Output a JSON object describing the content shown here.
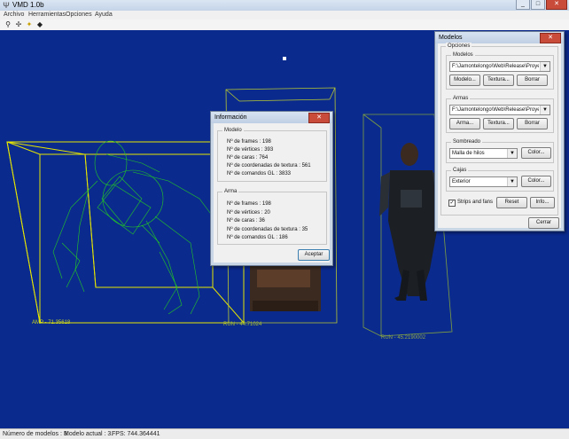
{
  "window": {
    "title": "VMD 1.0b",
    "icon": "app-icon"
  },
  "menu": [
    "Archivo",
    "Herramientas",
    "Opciones",
    "Ayuda"
  ],
  "toolbar": [
    "cursor-icon",
    "figure-icon",
    "lightbulb-icon",
    "tag-icon"
  ],
  "viewport": {
    "background": "#0b2a8e",
    "labels": {
      "left": "AMP - 71.35618",
      "middle": "RUN - 44.71024",
      "right": "RUN - 45.2190002"
    }
  },
  "status": {
    "models": "Número de modelos : 3.",
    "current": "Modelo actual : 3.",
    "fps": "FPS: 744.364441"
  },
  "info_dialog": {
    "title": "Información",
    "model_group": "Modelo",
    "model_lines": [
      "Nº de frames : 198",
      "Nº de vértices : 393",
      "Nº de caras : 764",
      "Nº de coordenadas de textura : 561",
      "Nº de comandos GL : 3833"
    ],
    "weapon_group": "Arma",
    "weapon_lines": [
      "Nº de frames : 198",
      "Nº de vértices : 20",
      "Nº de caras : 36",
      "Nº de coordenadas de textura : 35",
      "Nº de comandos GL : 186"
    ],
    "accept": "Aceptar"
  },
  "models_dialog": {
    "title": "Modelos",
    "options_group": "Opciones",
    "models_group": "Modelos",
    "model_path": "F:\\Jamontelongo\\Web\\Release\\Proyectos\\...",
    "model_btn": "Modelo...",
    "texture_btn": "Textura...",
    "delete_btn": "Borrar",
    "weapon_group": "Armas",
    "weapon_path": "F:\\Jamontelongo\\Web\\Release\\Proyectos\\...",
    "weapon_btn": "Arma...",
    "weapon_texture_btn": "Textura...",
    "weapon_delete_btn": "Borrar",
    "shading_group": "Sombreado",
    "shading_value": "Malla de hilos",
    "shading_color_btn": "Color...",
    "boxes_group": "Cajas",
    "boxes_value": "Exterior",
    "boxes_color_btn": "Color...",
    "strips_label": "Strips and fans",
    "strips_checked": true,
    "reset_btn": "Reset",
    "info_btn": "Info...",
    "close_btn": "Cerrar"
  }
}
